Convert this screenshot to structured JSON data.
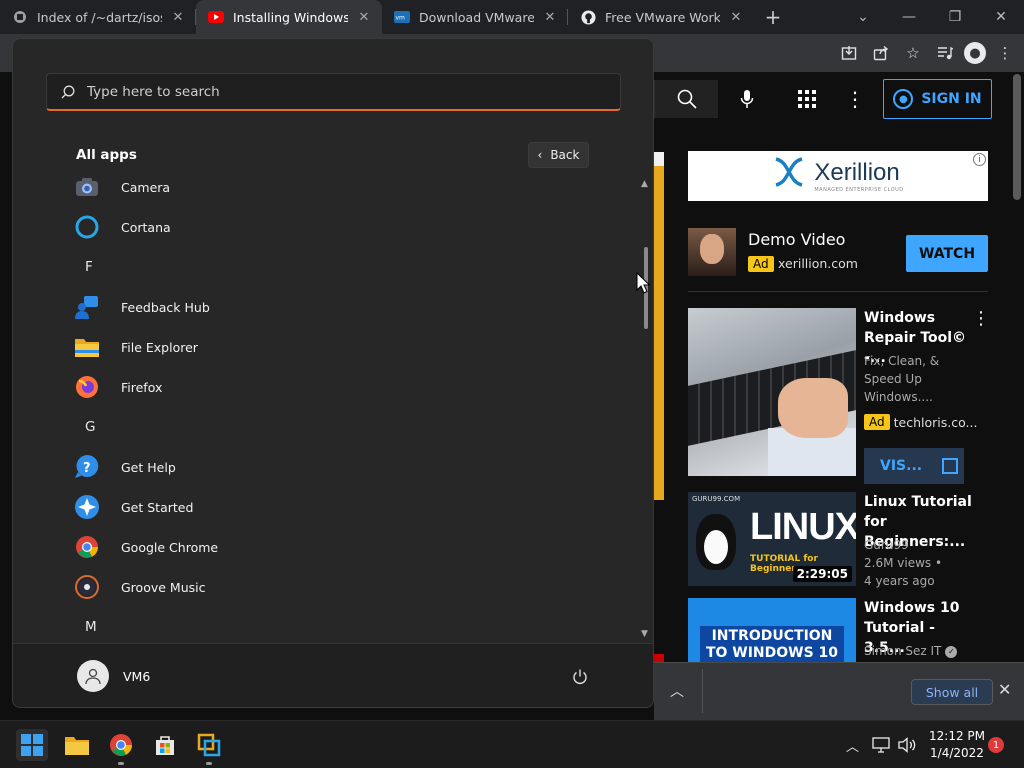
{
  "browser": {
    "tabs": [
      {
        "label": "Index of /~dartz/isos/",
        "icon": "site-icon"
      },
      {
        "label": "Installing Windows XP",
        "icon": "youtube-icon"
      },
      {
        "label": "Download VMware Wo",
        "icon": "vmware-icon"
      },
      {
        "label": "Free VMware Workstat",
        "icon": "github-icon"
      }
    ],
    "active_tab": 1
  },
  "youtube": {
    "sign_in_label": "SIGN IN",
    "ad_banner": {
      "brand": "Xerillion",
      "tagline": "MANAGED ENTERPRISE CLOUD"
    },
    "demo_ad": {
      "title": "Demo Video",
      "badge": "Ad",
      "domain": "xerillion.com",
      "cta": "WATCH"
    },
    "videos": [
      {
        "title": "Windows Repair Tool© -...",
        "meta": [
          "Fix, Clean, &",
          "Speed Up",
          "Windows...."
        ],
        "badge": "Ad",
        "domain": "techloris.co...",
        "cta": "VIS..."
      },
      {
        "title": "Linux Tutorial for Beginners:...",
        "thumb_text": "LINUX",
        "thumb_sub": "TUTORIAL for Beginner",
        "thumb_brand": "GURU99.COM",
        "duration": "2:29:05",
        "channel": "Guru99",
        "views": "2.6M views •",
        "age": "4 years ago"
      },
      {
        "title": "Windows 10 Tutorial - 3.5...",
        "thumb_text": "INTRODUCTION TO WINDOWS 10",
        "channel": "Simon Sez IT"
      }
    ]
  },
  "downloads": {
    "show_all": "Show all"
  },
  "start_menu": {
    "search_placeholder": "Type here to search",
    "all_apps": "All apps",
    "back": "Back",
    "letters": {
      "f": "F",
      "g": "G",
      "m": "M"
    },
    "apps": {
      "camera": "Camera",
      "cortana": "Cortana",
      "feedback": "Feedback Hub",
      "explorer": "File Explorer",
      "firefox": "Firefox",
      "gethelp": "Get Help",
      "getstarted": "Get Started",
      "chrome": "Google Chrome",
      "groove": "Groove Music"
    },
    "user": "VM6"
  },
  "taskbar": {
    "time": "12:12 PM",
    "date": "1/4/2022",
    "notifications": "1"
  },
  "colors": {
    "accent_orange": "#e86b2a",
    "youtube_blue": "#3ea6ff",
    "ad_yellow": "#f5c518"
  }
}
